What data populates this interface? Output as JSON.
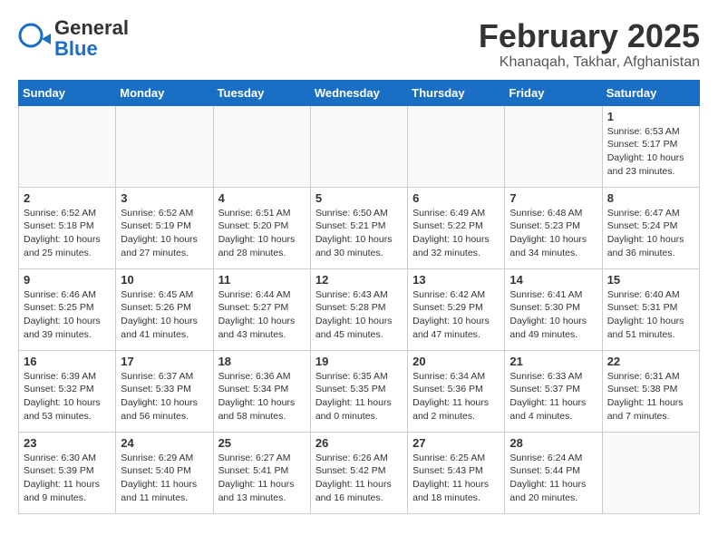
{
  "header": {
    "logo_general": "General",
    "logo_blue": "Blue",
    "month_title": "February 2025",
    "location": "Khanaqah, Takhar, Afghanistan"
  },
  "weekdays": [
    "Sunday",
    "Monday",
    "Tuesday",
    "Wednesday",
    "Thursday",
    "Friday",
    "Saturday"
  ],
  "weeks": [
    [
      {
        "day": "",
        "info": ""
      },
      {
        "day": "",
        "info": ""
      },
      {
        "day": "",
        "info": ""
      },
      {
        "day": "",
        "info": ""
      },
      {
        "day": "",
        "info": ""
      },
      {
        "day": "",
        "info": ""
      },
      {
        "day": "1",
        "info": "Sunrise: 6:53 AM\nSunset: 5:17 PM\nDaylight: 10 hours\nand 23 minutes."
      }
    ],
    [
      {
        "day": "2",
        "info": "Sunrise: 6:52 AM\nSunset: 5:18 PM\nDaylight: 10 hours\nand 25 minutes."
      },
      {
        "day": "3",
        "info": "Sunrise: 6:52 AM\nSunset: 5:19 PM\nDaylight: 10 hours\nand 27 minutes."
      },
      {
        "day": "4",
        "info": "Sunrise: 6:51 AM\nSunset: 5:20 PM\nDaylight: 10 hours\nand 28 minutes."
      },
      {
        "day": "5",
        "info": "Sunrise: 6:50 AM\nSunset: 5:21 PM\nDaylight: 10 hours\nand 30 minutes."
      },
      {
        "day": "6",
        "info": "Sunrise: 6:49 AM\nSunset: 5:22 PM\nDaylight: 10 hours\nand 32 minutes."
      },
      {
        "day": "7",
        "info": "Sunrise: 6:48 AM\nSunset: 5:23 PM\nDaylight: 10 hours\nand 34 minutes."
      },
      {
        "day": "8",
        "info": "Sunrise: 6:47 AM\nSunset: 5:24 PM\nDaylight: 10 hours\nand 36 minutes."
      }
    ],
    [
      {
        "day": "9",
        "info": "Sunrise: 6:46 AM\nSunset: 5:25 PM\nDaylight: 10 hours\nand 39 minutes."
      },
      {
        "day": "10",
        "info": "Sunrise: 6:45 AM\nSunset: 5:26 PM\nDaylight: 10 hours\nand 41 minutes."
      },
      {
        "day": "11",
        "info": "Sunrise: 6:44 AM\nSunset: 5:27 PM\nDaylight: 10 hours\nand 43 minutes."
      },
      {
        "day": "12",
        "info": "Sunrise: 6:43 AM\nSunset: 5:28 PM\nDaylight: 10 hours\nand 45 minutes."
      },
      {
        "day": "13",
        "info": "Sunrise: 6:42 AM\nSunset: 5:29 PM\nDaylight: 10 hours\nand 47 minutes."
      },
      {
        "day": "14",
        "info": "Sunrise: 6:41 AM\nSunset: 5:30 PM\nDaylight: 10 hours\nand 49 minutes."
      },
      {
        "day": "15",
        "info": "Sunrise: 6:40 AM\nSunset: 5:31 PM\nDaylight: 10 hours\nand 51 minutes."
      }
    ],
    [
      {
        "day": "16",
        "info": "Sunrise: 6:39 AM\nSunset: 5:32 PM\nDaylight: 10 hours\nand 53 minutes."
      },
      {
        "day": "17",
        "info": "Sunrise: 6:37 AM\nSunset: 5:33 PM\nDaylight: 10 hours\nand 56 minutes."
      },
      {
        "day": "18",
        "info": "Sunrise: 6:36 AM\nSunset: 5:34 PM\nDaylight: 10 hours\nand 58 minutes."
      },
      {
        "day": "19",
        "info": "Sunrise: 6:35 AM\nSunset: 5:35 PM\nDaylight: 11 hours\nand 0 minutes."
      },
      {
        "day": "20",
        "info": "Sunrise: 6:34 AM\nSunset: 5:36 PM\nDaylight: 11 hours\nand 2 minutes."
      },
      {
        "day": "21",
        "info": "Sunrise: 6:33 AM\nSunset: 5:37 PM\nDaylight: 11 hours\nand 4 minutes."
      },
      {
        "day": "22",
        "info": "Sunrise: 6:31 AM\nSunset: 5:38 PM\nDaylight: 11 hours\nand 7 minutes."
      }
    ],
    [
      {
        "day": "23",
        "info": "Sunrise: 6:30 AM\nSunset: 5:39 PM\nDaylight: 11 hours\nand 9 minutes."
      },
      {
        "day": "24",
        "info": "Sunrise: 6:29 AM\nSunset: 5:40 PM\nDaylight: 11 hours\nand 11 minutes."
      },
      {
        "day": "25",
        "info": "Sunrise: 6:27 AM\nSunset: 5:41 PM\nDaylight: 11 hours\nand 13 minutes."
      },
      {
        "day": "26",
        "info": "Sunrise: 6:26 AM\nSunset: 5:42 PM\nDaylight: 11 hours\nand 16 minutes."
      },
      {
        "day": "27",
        "info": "Sunrise: 6:25 AM\nSunset: 5:43 PM\nDaylight: 11 hours\nand 18 minutes."
      },
      {
        "day": "28",
        "info": "Sunrise: 6:24 AM\nSunset: 5:44 PM\nDaylight: 11 hours\nand 20 minutes."
      },
      {
        "day": "",
        "info": ""
      }
    ]
  ]
}
